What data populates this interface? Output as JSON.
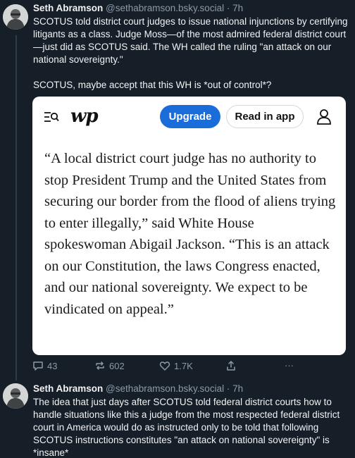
{
  "post1": {
    "author_name": "Seth Abramson",
    "handle": "@sethabramson.bsky.social",
    "separator": "·",
    "time": "7h",
    "text_p1": "SCOTUS told district court judges to issue national injunctions by certifying litigants as a class. Judge Moss—of the most admired federal district court—just did as SCOTUS said. The WH called the ruling \"an attack on our national sovereignty.\"",
    "text_p2": "SCOTUS, maybe accept that this WH is *out of control*?",
    "embed": {
      "logo": "wp",
      "upgrade_label": "Upgrade",
      "read_in_app_label": "Read in app",
      "quote": "“A local district court judge has no authority to stop President Trump and the United States from securing our border from the flood of aliens trying to enter illegally,” said White House spokeswoman Abigail Jackson. “This is an attack on our Constitution, the laws Congress enacted, and our national sovereignty. We expect to be vindicated on appeal.”"
    },
    "actions": {
      "replies": "43",
      "reposts": "602",
      "likes": "1.7K",
      "more": "···"
    }
  },
  "post2": {
    "author_name": "Seth Abramson",
    "handle": "@sethabramson.bsky.social",
    "separator": "·",
    "time": "7h",
    "text": "The idea that just days after SCOTUS told federal district courts how to handle situations like this a judge from the most respected federal district court in America would do as instructed only to be told that following SCOTUS instructions constitutes \"an attack on national sovereignty\" is *insane*"
  },
  "icons": [
    "menu-search-icon",
    "profile-icon",
    "reply-icon",
    "repost-icon",
    "like-icon",
    "share-icon",
    "more-icon"
  ],
  "colors": {
    "background": "#161e27",
    "upgrade_button": "#1a6dd9",
    "muted_text": "#8c9aa8"
  }
}
